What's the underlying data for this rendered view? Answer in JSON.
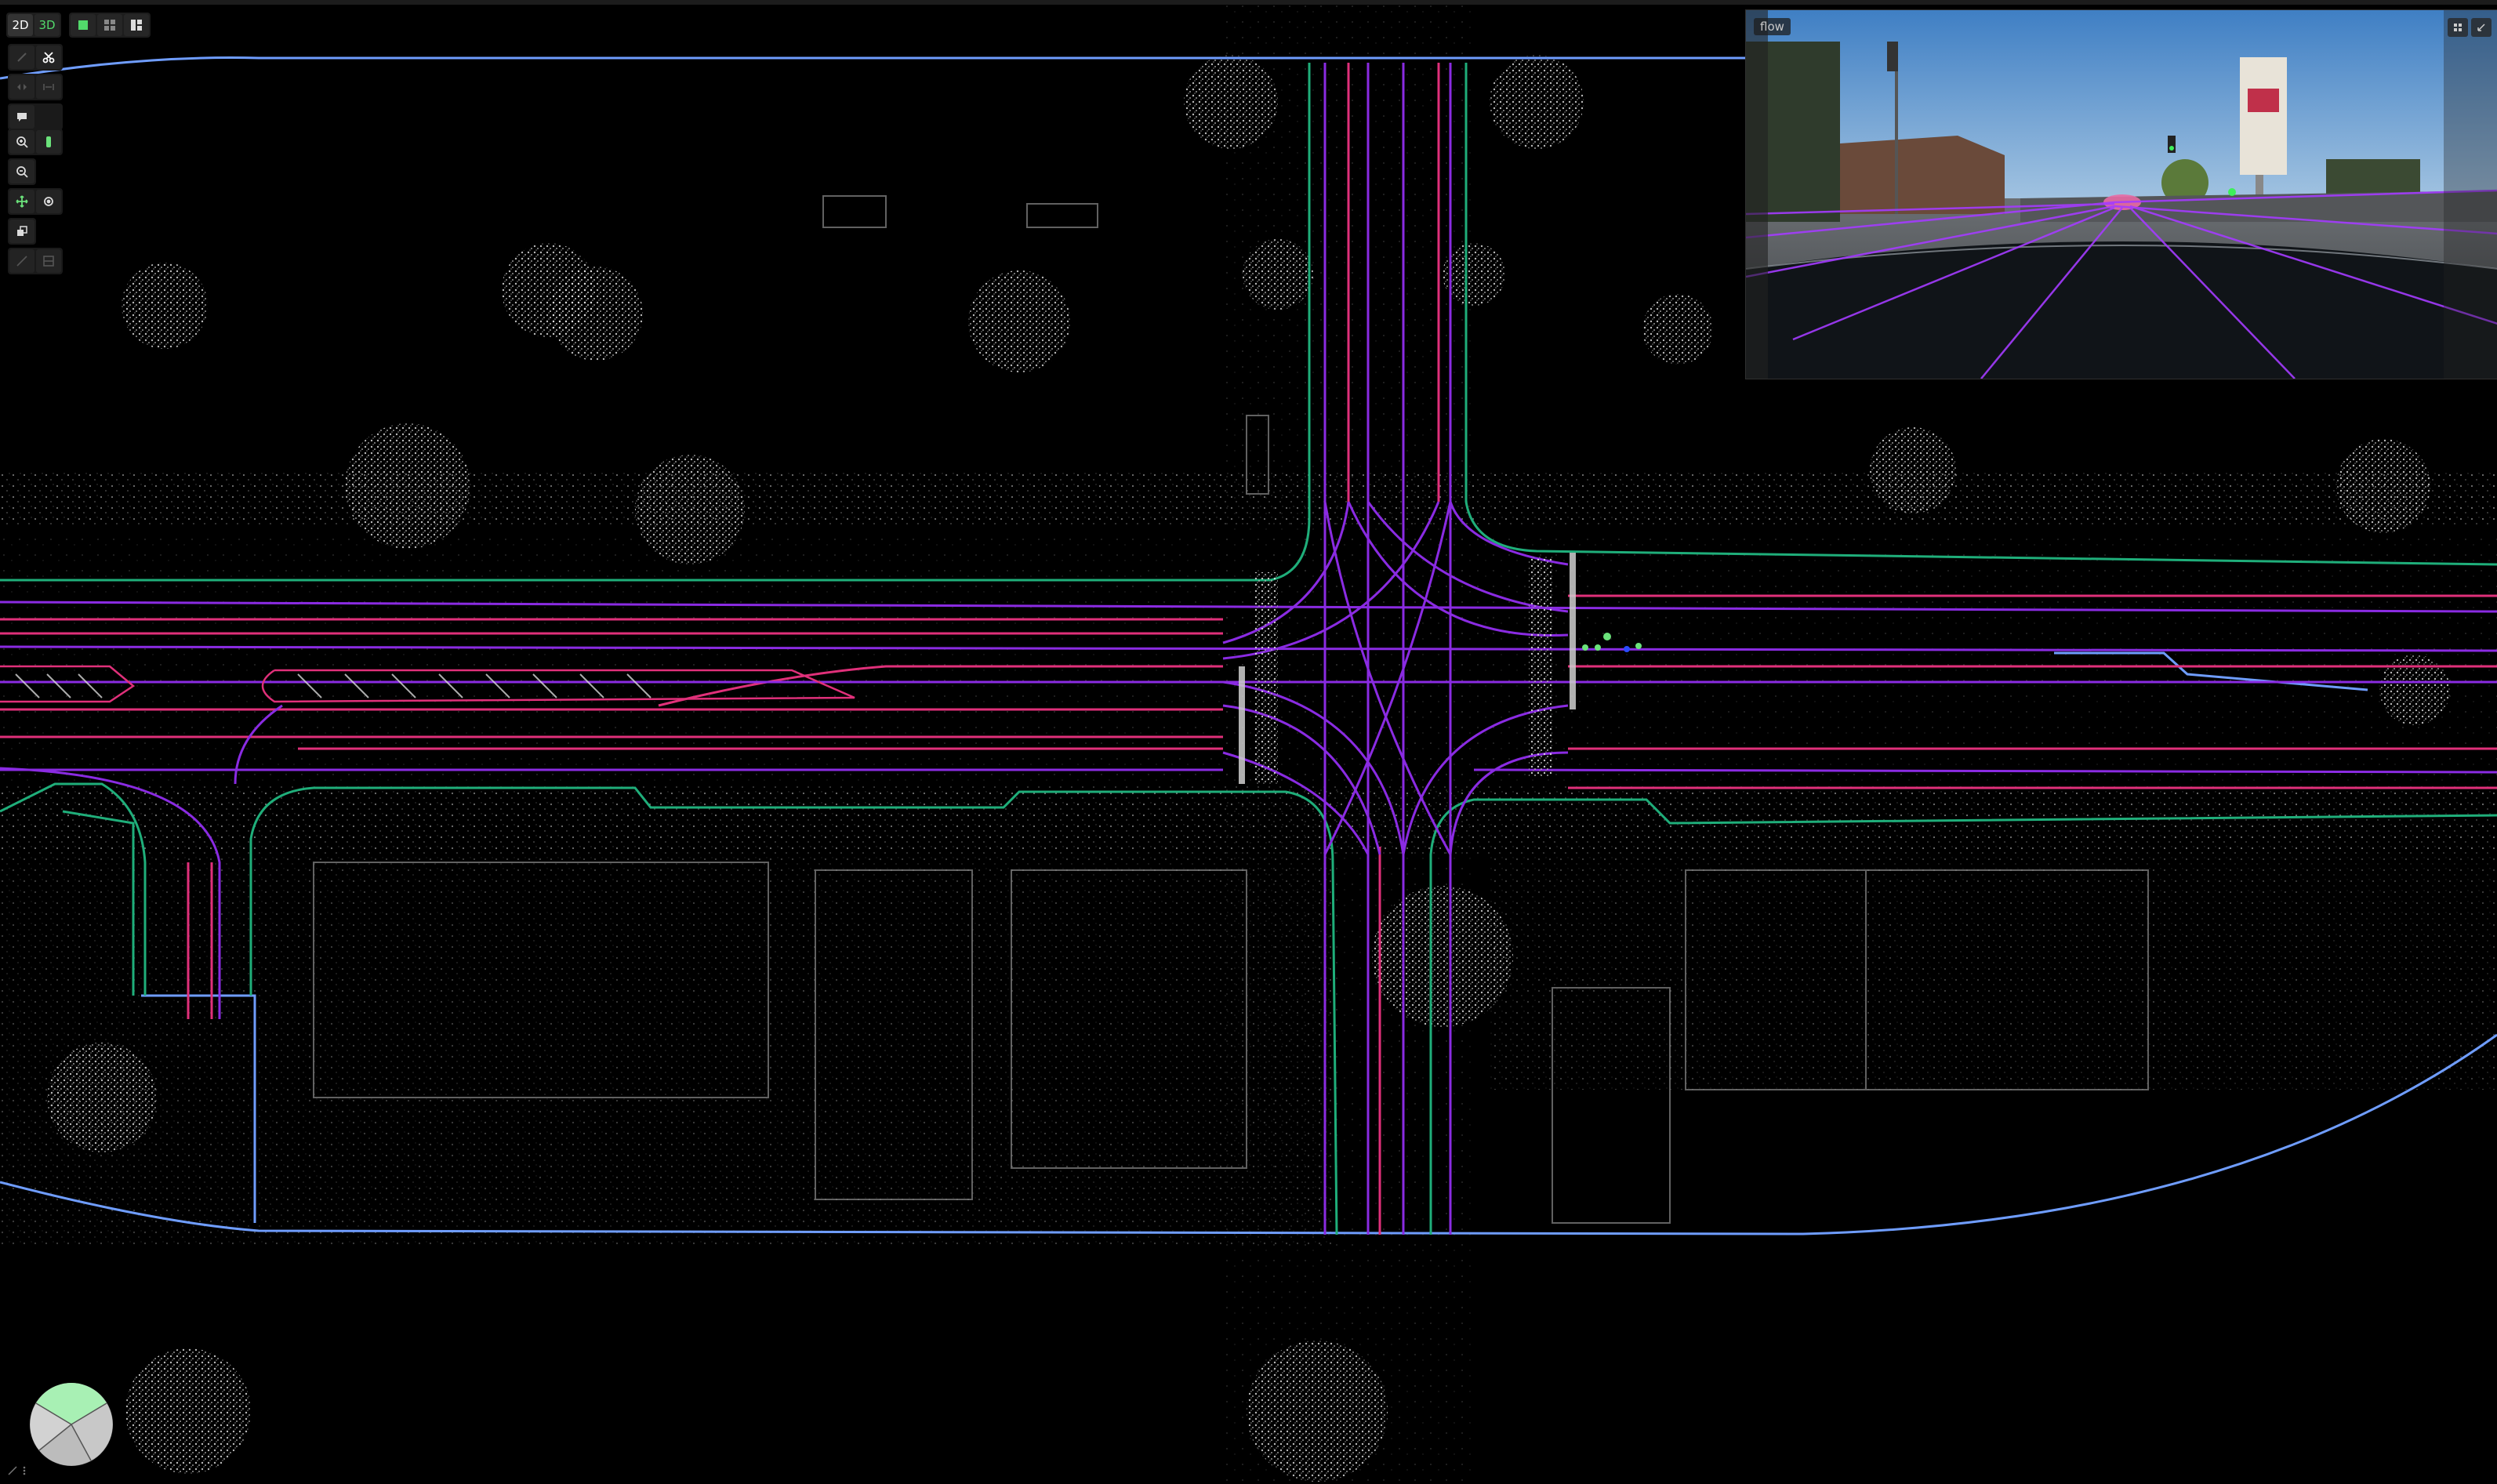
{
  "toolbar": {
    "mode_2d": "2D",
    "mode_3d": "3D",
    "view_buttons": [
      "single-view-icon",
      "grid-view-icon",
      "split-view-icon"
    ]
  },
  "left_tools": [
    [
      "select-icon",
      "cut-icon"
    ],
    [
      "move-horizontal-icon",
      "measure-icon"
    ],
    [
      "comment-icon"
    ],
    [
      "zoom-in-icon",
      "traffic-light-icon"
    ],
    [
      "zoom-out-icon"
    ],
    [
      "pan-icon",
      "rotate-icon"
    ],
    [
      "layers-icon"
    ],
    [
      "line-tool-icon",
      "box-tool-icon"
    ]
  ],
  "camera": {
    "label": "flow",
    "actions": [
      "expand-icon",
      "collapse-icon"
    ]
  },
  "compass": {
    "icon": "compass-icon"
  },
  "colors": {
    "background": "#000000",
    "boundary_blue": "#6f9dff",
    "lane_magenta": "#e0307a",
    "lane_purple": "#8a2be2",
    "curb_green": "#1fae7a",
    "signal_green": "#6be37b"
  }
}
